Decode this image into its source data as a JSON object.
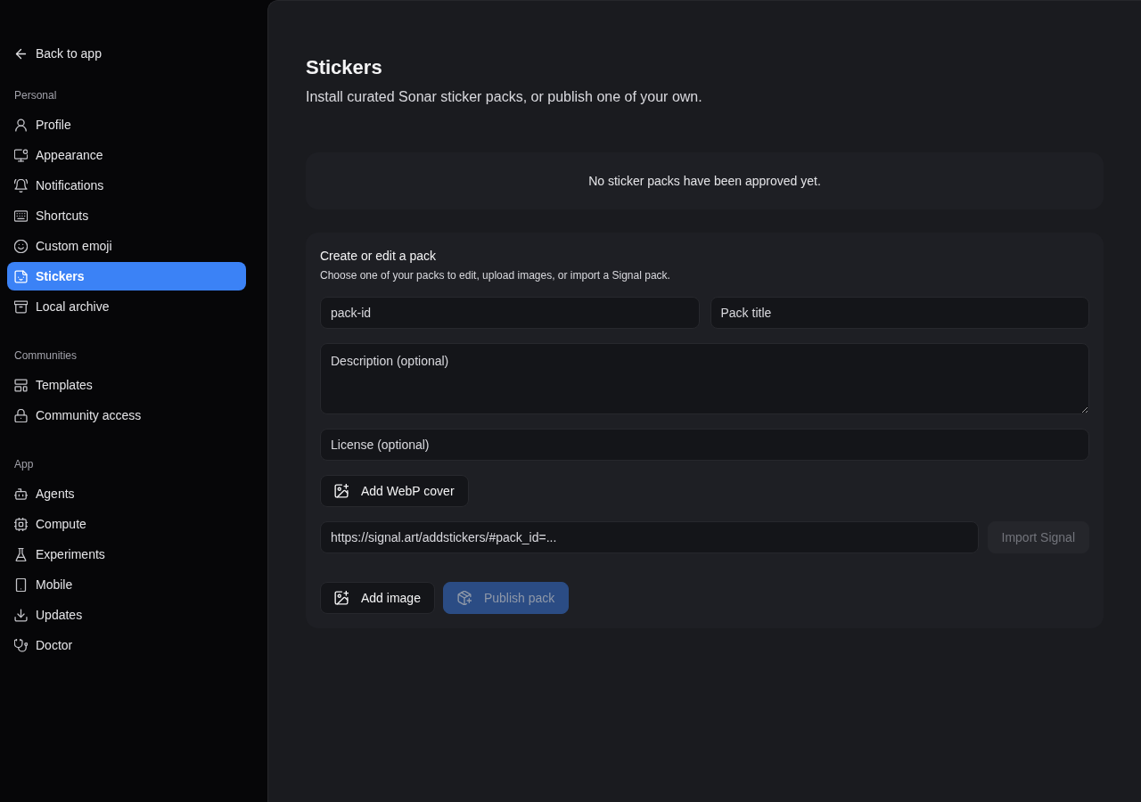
{
  "sidebar": {
    "back_link": "Back to app",
    "sections": [
      {
        "heading": "Personal",
        "items": [
          {
            "label": "Profile",
            "selected": false
          },
          {
            "label": "Appearance",
            "selected": false
          },
          {
            "label": "Notifications",
            "selected": false
          },
          {
            "label": "Shortcuts",
            "selected": false
          },
          {
            "label": "Custom emoji",
            "selected": false
          },
          {
            "label": "Stickers",
            "selected": true
          },
          {
            "label": "Local archive",
            "selected": false
          }
        ]
      },
      {
        "heading": "Communities",
        "items": [
          {
            "label": "Templates",
            "selected": false
          },
          {
            "label": "Community access",
            "selected": false
          }
        ]
      },
      {
        "heading": "App",
        "items": [
          {
            "label": "Agents",
            "selected": false
          },
          {
            "label": "Compute",
            "selected": false
          },
          {
            "label": "Experiments",
            "selected": false
          },
          {
            "label": "Mobile",
            "selected": false
          },
          {
            "label": "Updates",
            "selected": false
          },
          {
            "label": "Doctor",
            "selected": false
          }
        ]
      }
    ]
  },
  "header": {
    "title": "Stickers",
    "subtitle": "Install curated Sonar sticker packs, or publish one of your own."
  },
  "approved_packs": {
    "empty_message": "No sticker packs have been approved yet."
  },
  "editor": {
    "title": "Create or edit a pack",
    "description": "Choose one of your packs to edit, upload images, or import a Signal pack.",
    "pack_id": {
      "placeholder": "pack-id"
    },
    "pack_title": {
      "placeholder": "Pack title"
    },
    "description_field": {
      "placeholder": "Description (optional)"
    },
    "license": {
      "placeholder": "License (optional)"
    },
    "cover_button": {
      "label": "Add WebP cover",
      "disabled": false
    },
    "signal_url": {
      "placeholder": "https://signal.art/addstickers/#pack_id=..."
    },
    "import_button": {
      "label": "Import Signal",
      "disabled": true
    },
    "actions": [
      {
        "label": "Add image",
        "kind": "secondary",
        "disabled": false
      },
      {
        "label": "Publish pack",
        "kind": "primary",
        "disabled": true
      }
    ]
  }
}
